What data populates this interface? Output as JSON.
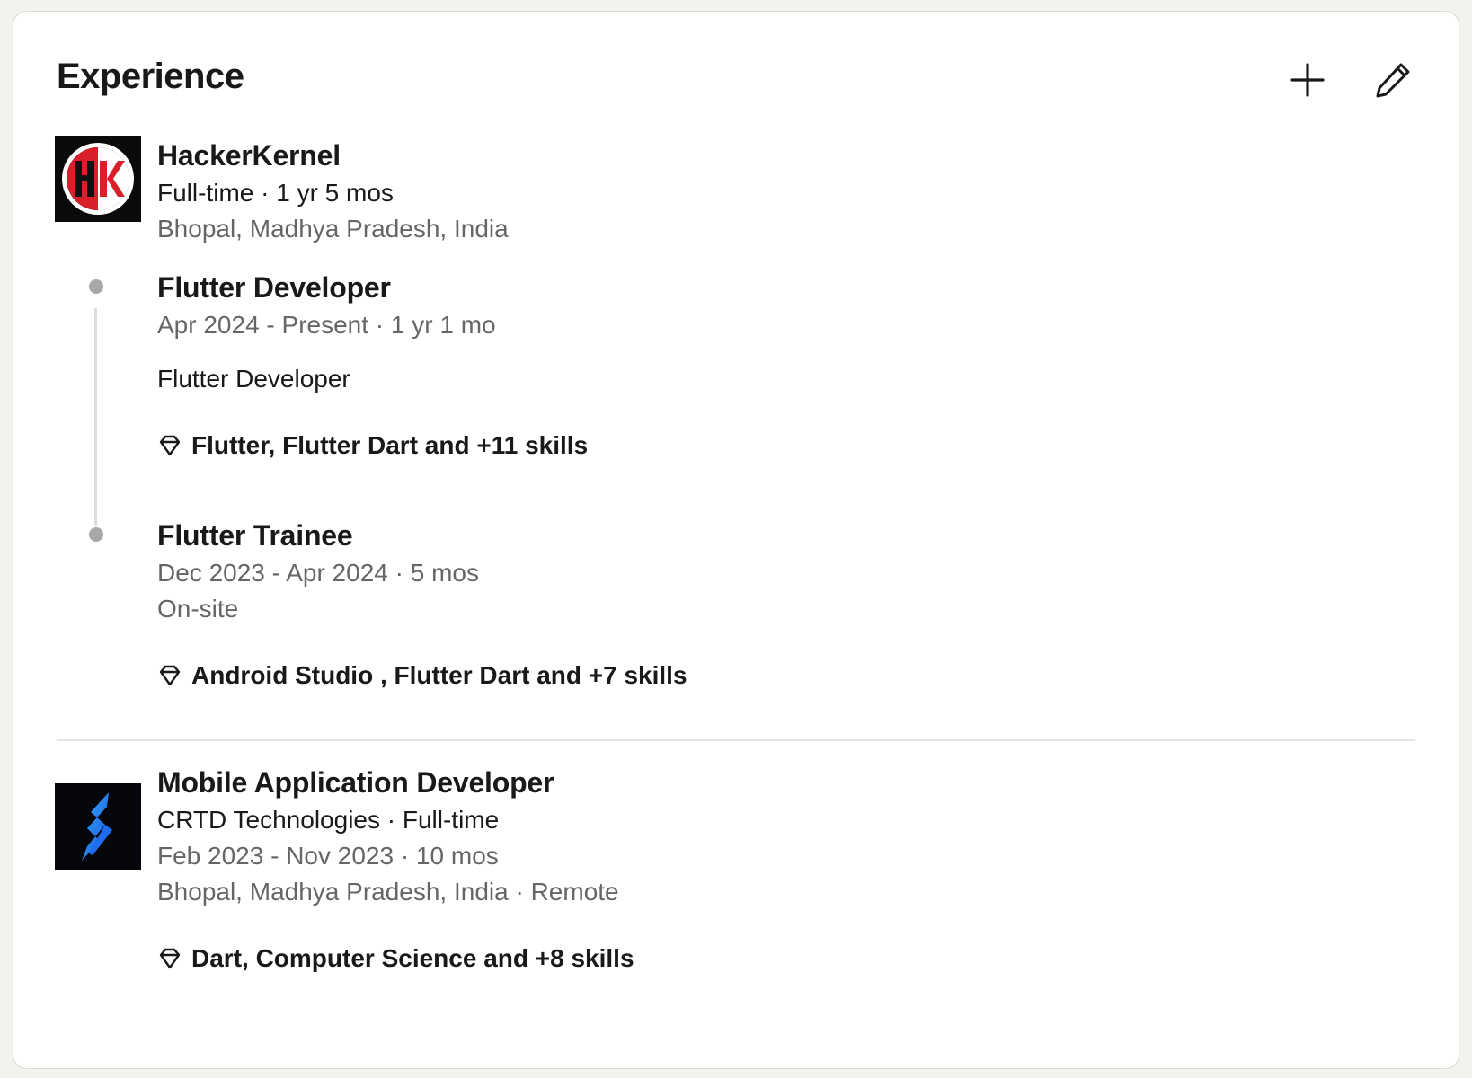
{
  "section": {
    "title": "Experience",
    "add_icon": "plus-icon",
    "edit_icon": "pencil-icon"
  },
  "companies": [
    {
      "name": "HackerKernel",
      "logo": "hk-logo",
      "logo_text": "HK",
      "employment": "Full-time · 1 yr 5 mos",
      "location": "Bhopal, Madhya Pradesh, India",
      "roles": [
        {
          "title": "Flutter Developer",
          "dates": "Apr 2024 - Present · 1 yr 1 mo",
          "description": "Flutter Developer",
          "skills": "Flutter, Flutter Dart and +11 skills"
        },
        {
          "title": "Flutter Trainee",
          "dates": "Dec 2023 - Apr 2024 · 5 mos",
          "workplace": "On-site",
          "skills": "Android Studio , Flutter Dart and +7 skills"
        }
      ]
    },
    {
      "title": "Mobile Application Developer",
      "logo": "crtd-logo",
      "company_line": "CRTD Technologies · Full-time",
      "dates": "Feb 2023 - Nov 2023 · 10 mos",
      "location": "Bhopal, Madhya Pradesh, India · Remote",
      "skills": "Dart, Computer Science and +8 skills"
    }
  ],
  "colors": {
    "background": "#f3f2ee",
    "card": "#ffffff",
    "text": "#191919",
    "muted": "#666666",
    "hk_red": "#d81f2a"
  }
}
